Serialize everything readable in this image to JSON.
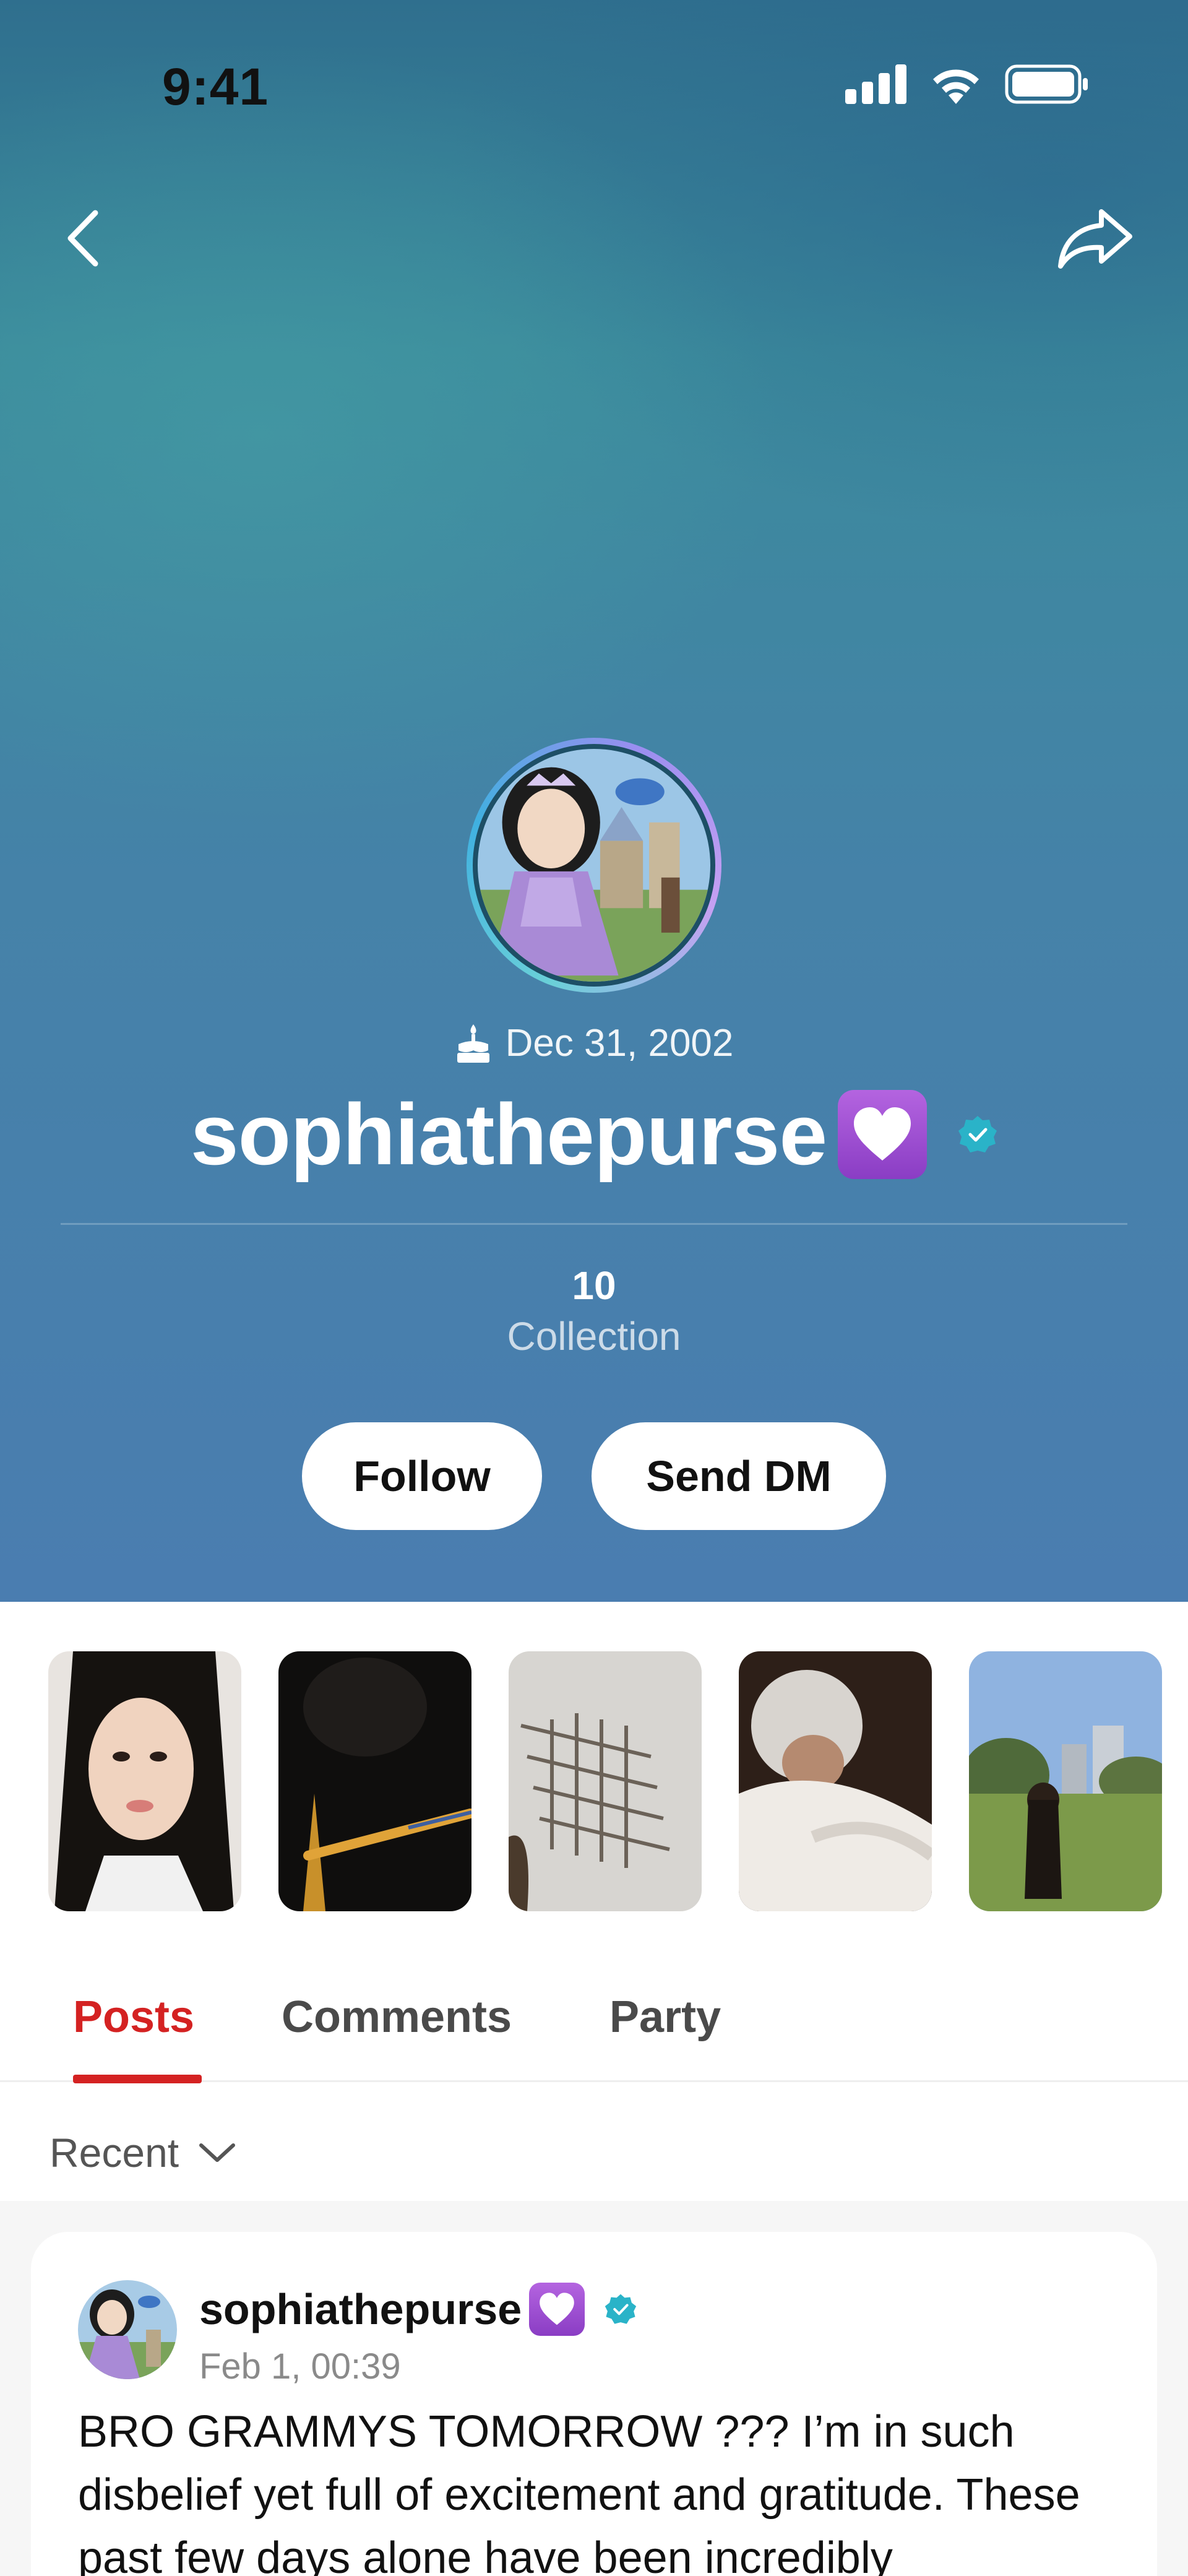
{
  "status_bar": {
    "time": "9:41"
  },
  "profile": {
    "birthday": "Dec 31, 2002",
    "username": "sophiathepurse",
    "stats": {
      "count": "10",
      "label": "Collection"
    },
    "buttons": {
      "follow": "Follow",
      "dm": "Send DM"
    }
  },
  "tabs": [
    "Posts",
    "Comments",
    "Party"
  ],
  "sort": {
    "label": "Recent"
  },
  "post": {
    "author": "sophiathepurse",
    "date": "Feb 1, 00:39",
    "text": "BRO GRAMMYS TOMORROW ??? I’m in such disbelief yet full of excitement and gratitude. These past few days alone have been incredibly"
  },
  "colors": {
    "accent": "#d42222",
    "verified": "#2ab3c8",
    "heart": "#9b4fd6"
  }
}
